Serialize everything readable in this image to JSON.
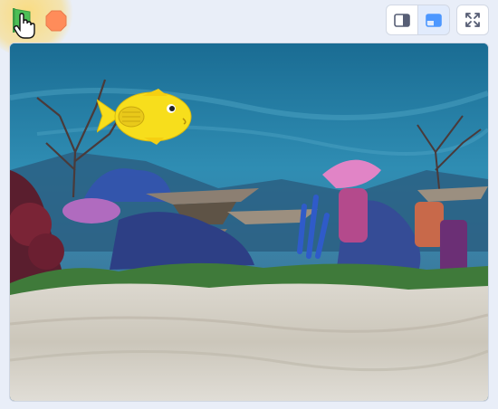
{
  "header": {
    "green_flag": {
      "icon": "green-flag-icon",
      "color": "#4cbf56"
    },
    "stop": {
      "icon": "stop-sign-icon",
      "color": "#ff8c5a"
    },
    "view_buttons": [
      {
        "icon": "small-stage-icon"
      },
      {
        "icon": "normal-stage-icon",
        "selected": true
      },
      {
        "icon": "fullscreen-icon"
      }
    ]
  },
  "stage": {
    "backdrop": "underwater",
    "sprite": {
      "name": "fish",
      "color": "#f7de1c"
    }
  },
  "colors": {
    "accent": "#4c97ff",
    "background": "#e9eef8",
    "flag_green": "#4cbf56",
    "stop_orange": "#ff8c5a"
  }
}
